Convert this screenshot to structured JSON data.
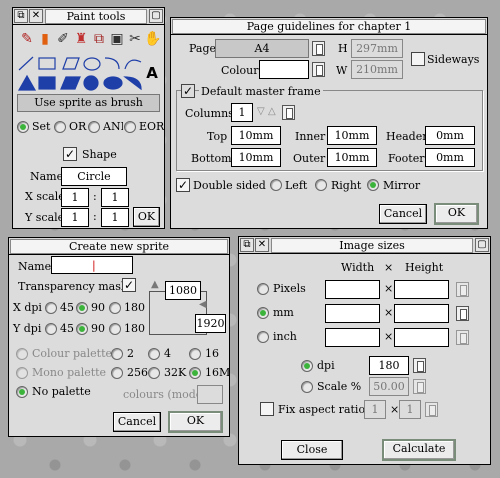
{
  "paint_tools": {
    "title": "Paint tools",
    "use_sprite_label": "Use sprite as brush",
    "modes": [
      "Set",
      "OR",
      "AND",
      "EOR"
    ],
    "shape_label": "Shape",
    "name_label": "Name",
    "name_value": "Circle",
    "xscale_label": "X scale",
    "xscale_num": "1",
    "xscale_den": "1",
    "yscale_label": "Y scale",
    "yscale_num": "1",
    "yscale_den": "1",
    "colon": ":",
    "ok_label": "OK",
    "text_tool": "A"
  },
  "page_guidelines": {
    "title": "Page guidelines for chapter 1",
    "page_label": "Page",
    "page_value": "A4",
    "h_label": "H",
    "h_value": "297mm",
    "colour_label": "Colour",
    "colour_value": "",
    "w_label": "W",
    "w_value": "210mm",
    "sideways_label": "Sideways",
    "default_master_label": "Default master frame",
    "columns_label": "Columns",
    "columns_value": "1",
    "top_label": "Top",
    "top_value": "10mm",
    "inner_label": "Inner",
    "inner_value": "10mm",
    "header_label": "Header",
    "header_value": "0mm",
    "bottom_label": "Bottom",
    "bottom_value": "10mm",
    "outer_label": "Outer",
    "outer_value": "10mm",
    "footer_label": "Footer",
    "footer_value": "0mm",
    "double_sided_label": "Double sided",
    "left_label": "Left",
    "right_label": "Right",
    "mirror_label": "Mirror",
    "cancel_label": "Cancel",
    "ok_label": "OK"
  },
  "create_sprite": {
    "title": "Create new sprite",
    "name_label": "Name",
    "name_value": "",
    "transparency_label": "Transparency mask",
    "xdpi_label": "X dpi",
    "ydpi_label": "Y dpi",
    "dpi_options": [
      "45",
      "90",
      "180"
    ],
    "width_value": "1080",
    "height_value": "1920",
    "colour_palette_label": "Colour palette",
    "mono_palette_label": "Mono palette",
    "no_palette_label": "No palette",
    "colour_options": [
      "2",
      "4",
      "16",
      "256",
      "32K",
      "16M"
    ],
    "colours_mode_label": "colours (mode",
    "colours_mode_value": "",
    "cancel_label": "Cancel",
    "ok_label": "OK"
  },
  "image_sizes": {
    "title": "Image sizes",
    "width_header": "Width",
    "x_header": "×",
    "height_header": "Height",
    "pixels_label": "Pixels",
    "mm_label": "mm",
    "inch_label": "inch",
    "times": "×",
    "dpi_label": "dpi",
    "dpi_value": "180",
    "scale_label": "Scale %",
    "scale_value": "50.00",
    "fix_aspect_label": "Fix aspect ratio",
    "aspect_num": "1",
    "aspect_den": "1",
    "close_label": "Close",
    "calculate_label": "Calculate"
  },
  "colors": {
    "radio_on": "#3cb43c",
    "tool_blue": "#1f3fa8",
    "window_bg": "#dcdcdc"
  }
}
